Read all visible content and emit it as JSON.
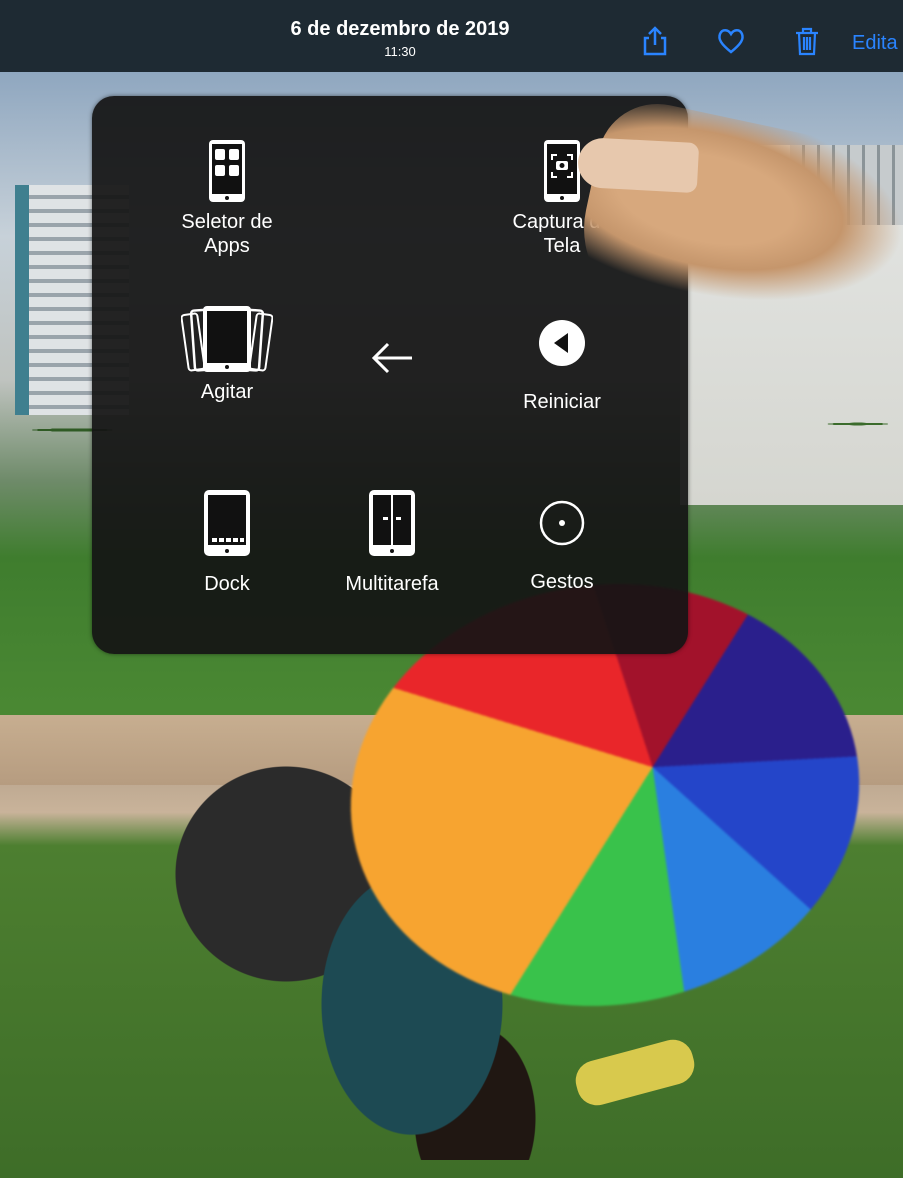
{
  "header": {
    "date": "6 de dezembro de 2019",
    "time": "11:30",
    "edit_label": "Edita",
    "icons": [
      "share-icon",
      "heart-icon",
      "trash-icon"
    ],
    "accent_color": "#2a84ff"
  },
  "menu": {
    "items": [
      {
        "label": "Seletor de\nApps",
        "icon": "app-switcher-icon"
      },
      {
        "label": "Captura de\nTela",
        "icon": "screenshot-icon"
      },
      {
        "label": "Agitar",
        "icon": "shake-icon"
      },
      {
        "label": "",
        "icon": "back-arrow-icon"
      },
      {
        "label": "Reiniciar",
        "icon": "restart-icon"
      },
      {
        "label": "Dock",
        "icon": "dock-icon"
      },
      {
        "label": "Multitarefa",
        "icon": "multitasking-icon"
      },
      {
        "label": "Gestos",
        "icon": "gestures-icon"
      }
    ]
  }
}
